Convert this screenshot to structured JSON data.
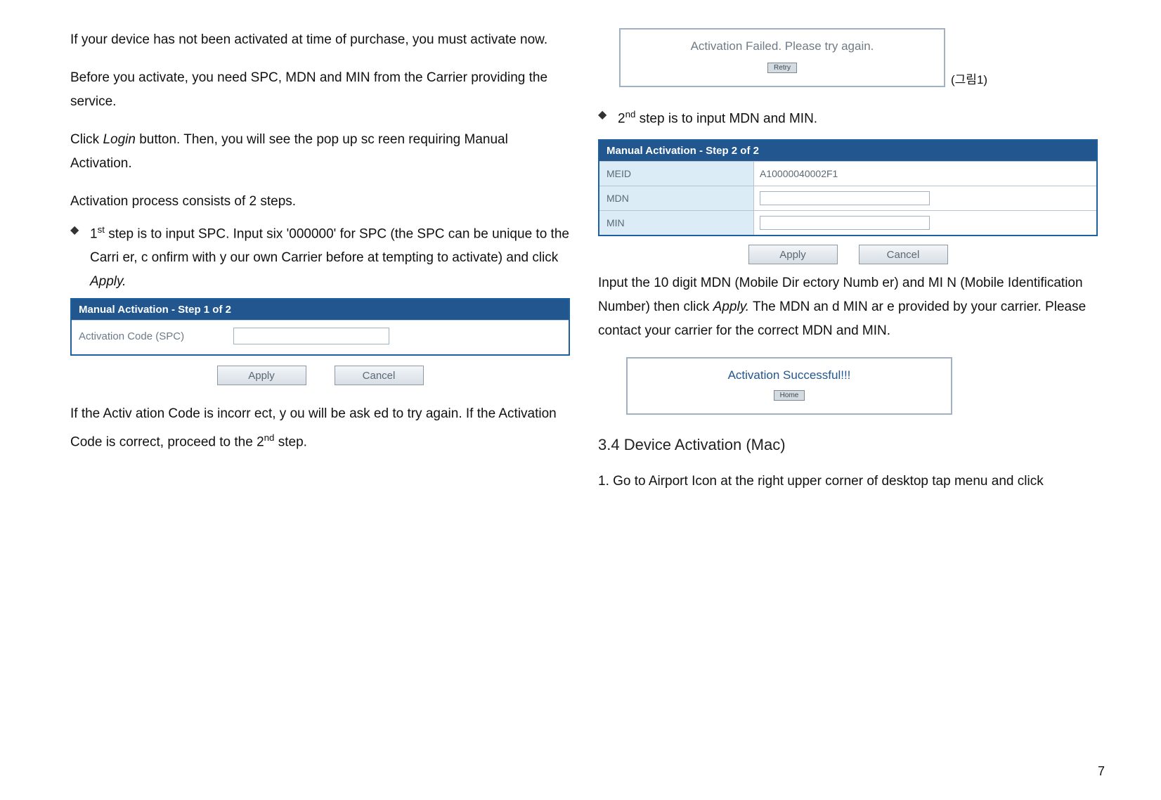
{
  "left": {
    "p1": "If your device has not been activated at time of purchase, you must activate now.",
    "p2": "Before you activate, you need SPC, MDN and MIN from the Carrier providing the service.",
    "p3_pre": "Click ",
    "p3_em": "Login",
    "p3_post": " button. Then, you will see the pop up sc reen requiring Manual Activation.",
    "p4": "Activation process consists of 2 steps.",
    "step1_pre": "1",
    "step1_sup": "st",
    "step1_mid": " step is to input SPC. Input six '000000' for SPC (the SPC can be unique to the  Carri er, c onfirm  with y our  own Carrier   before at tempting to activate) and click ",
    "step1_em": "Apply.",
    "panel1_head": "Manual Activation - Step 1 of 2",
    "panel1_label": "Activation Code (SPC)",
    "apply": "Apply",
    "cancel": "Cancel",
    "p5_a": "If the Activ ation Code is incorr  ect, y ou will be ask  ed to try again. If the Activation Code is correct, proceed to the 2",
    "p5_sup": "nd",
    "p5_b": " step."
  },
  "right": {
    "fail_msg": "Activation Failed. Please try again.",
    "retry": "Retry",
    "fail_cap": "(그림1)",
    "step2_pre": "2",
    "step2_sup": "nd",
    "step2_post": " step is to input MDN and MIN.",
    "panel2_head": "Manual Activation - Step 2 of 2",
    "row_meid": "MEID",
    "val_meid": "A10000040002F1",
    "row_mdn": "MDN",
    "row_min": "MIN",
    "apply": "Apply",
    "cancel": "Cancel",
    "p6_a": "Input the 10 digit MDN (Mobile Dir        ectory Numb er) and MI   N (Mobile Identification Number) then click  ",
    "p6_em": "Apply.",
    "p6_b": " The MDN an d MIN ar e provided by your carrier. Please contact your carrier for the correct MDN and MIN.",
    "succ_msg": "Activation Successful!!!",
    "home": "Home",
    "heading": "3.4 Device Activation (Mac)",
    "p7": "1. Go to Airport Icon at the right upper corner of desktop tap menu and click"
  },
  "page_number": "7"
}
